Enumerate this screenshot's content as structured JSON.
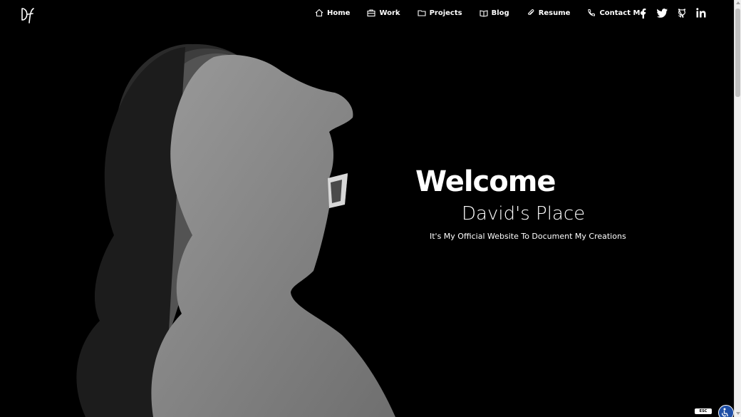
{
  "logo": {
    "alt": "Df"
  },
  "nav": [
    {
      "label": "Home",
      "icon": "home-icon"
    },
    {
      "label": "Work",
      "icon": "briefcase-icon"
    },
    {
      "label": "Projects",
      "icon": "folder-icon"
    },
    {
      "label": "Blog",
      "icon": "book-icon"
    },
    {
      "label": "Resume",
      "icon": "paperclip-icon"
    },
    {
      "label": "Contact Me",
      "icon": "phone-icon"
    }
  ],
  "social": [
    "facebook-icon",
    "twitter-icon",
    "github-icon",
    "linkedin-icon"
  ],
  "hero": {
    "title": "Welcome",
    "subtitle": "David's Place",
    "tagline": "It's My Official Website To Document My Creations"
  },
  "widgets": {
    "esc_label": "ESC"
  },
  "colors": {
    "background": "#000000",
    "text": "#ffffff",
    "silhouette": "#8a8a8a",
    "a11y": "#1f4fa6"
  }
}
